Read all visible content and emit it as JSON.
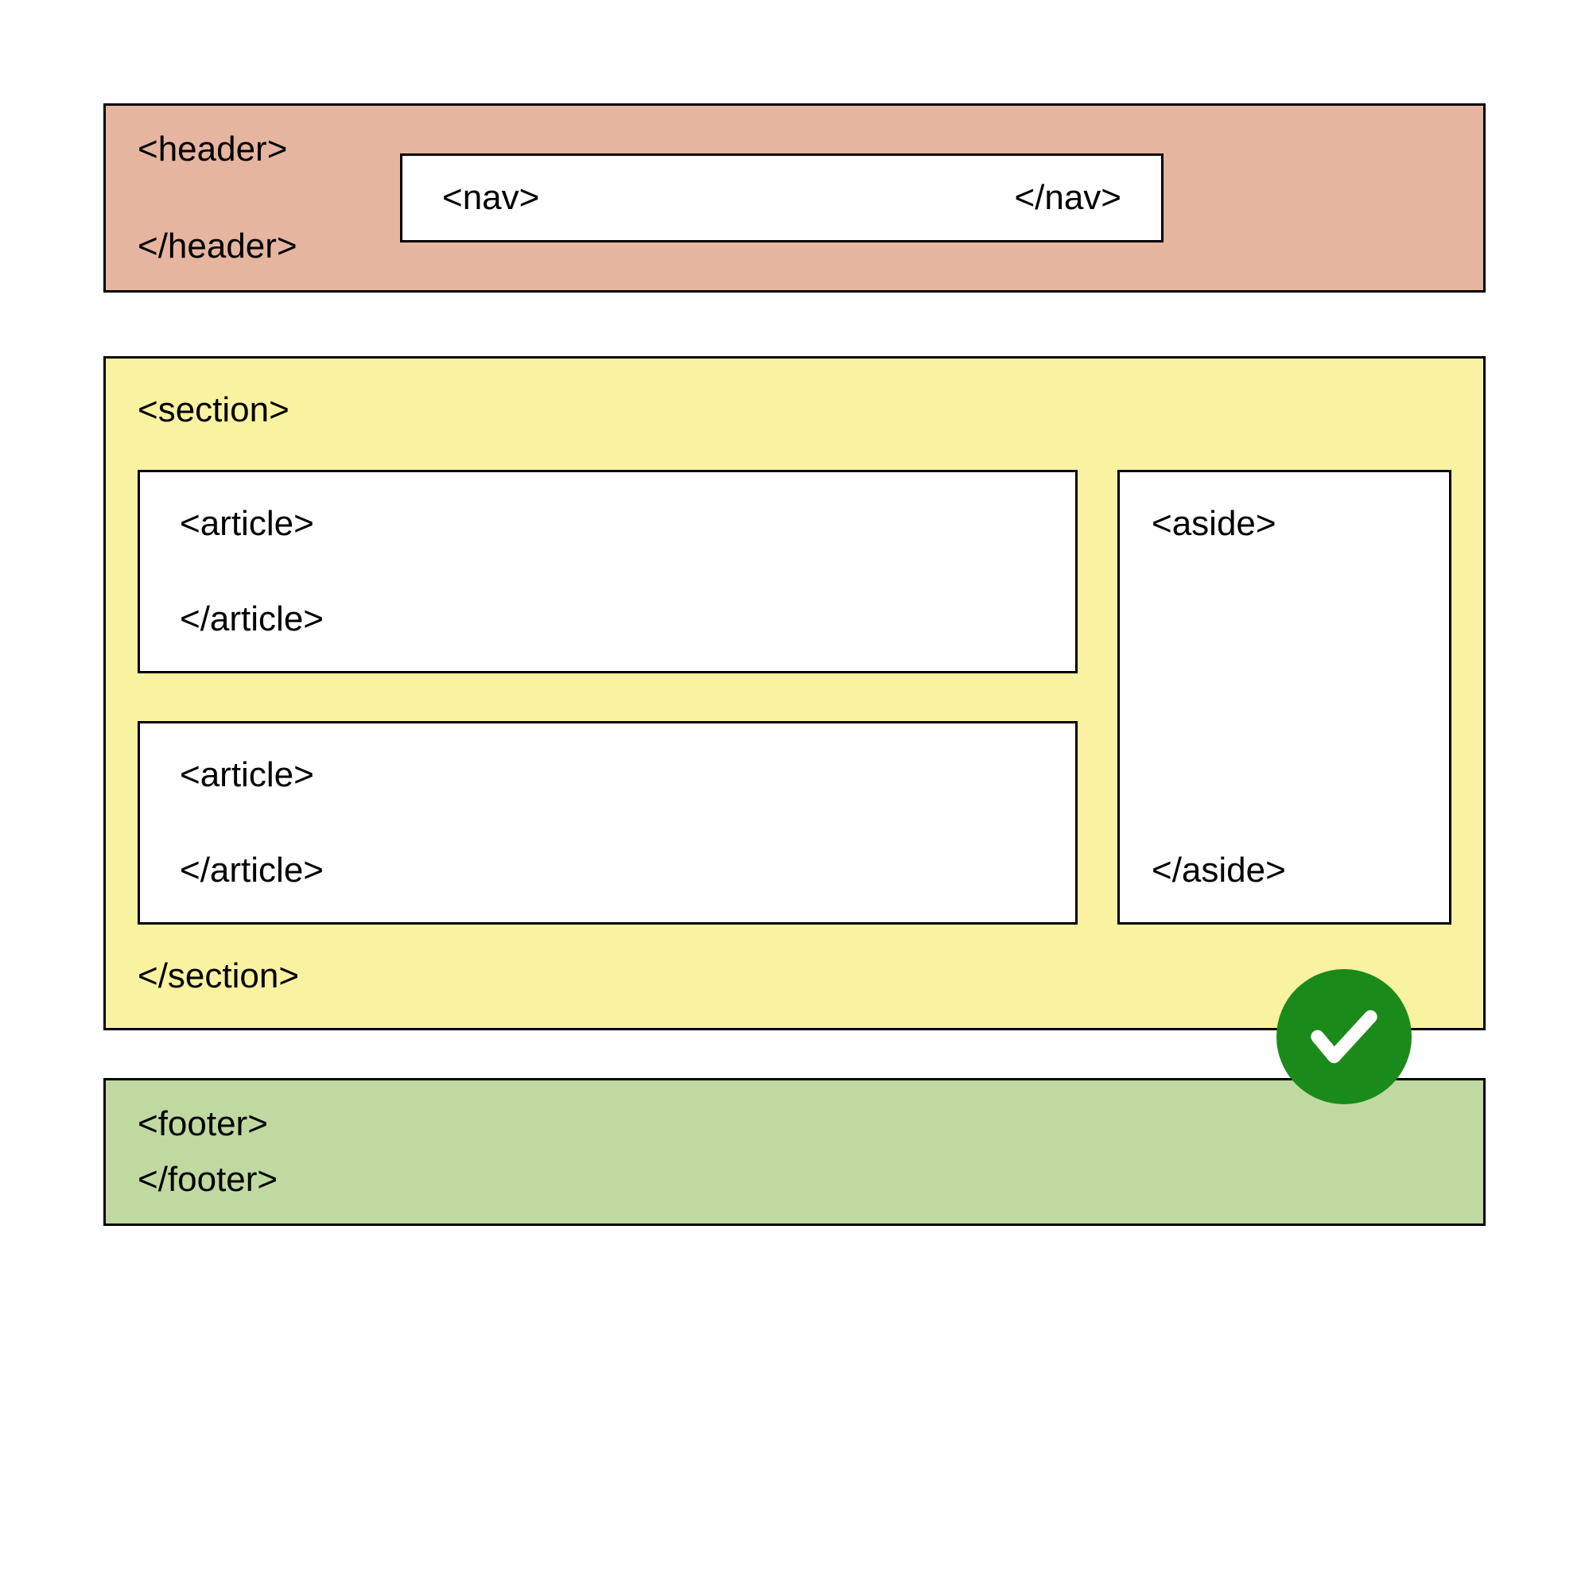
{
  "header": {
    "open_tag": "<header>",
    "close_tag": "</header>",
    "nav": {
      "open_tag": "<nav>",
      "close_tag": "</nav>"
    },
    "color": "#e6b5a0"
  },
  "section": {
    "open_tag": "<section>",
    "close_tag": "</section>",
    "color": "#f9f2a0",
    "articles": [
      {
        "open_tag": "<article>",
        "close_tag": "</article>"
      },
      {
        "open_tag": "<article>",
        "close_tag": "</article>"
      }
    ],
    "aside": {
      "open_tag": "<aside>",
      "close_tag": "</aside>"
    }
  },
  "footer": {
    "open_tag": "<footer>",
    "close_tag": "</footer>",
    "color": "#c0d9a0"
  },
  "badge": {
    "icon": "checkmark-icon",
    "color": "#1a8b1a"
  }
}
